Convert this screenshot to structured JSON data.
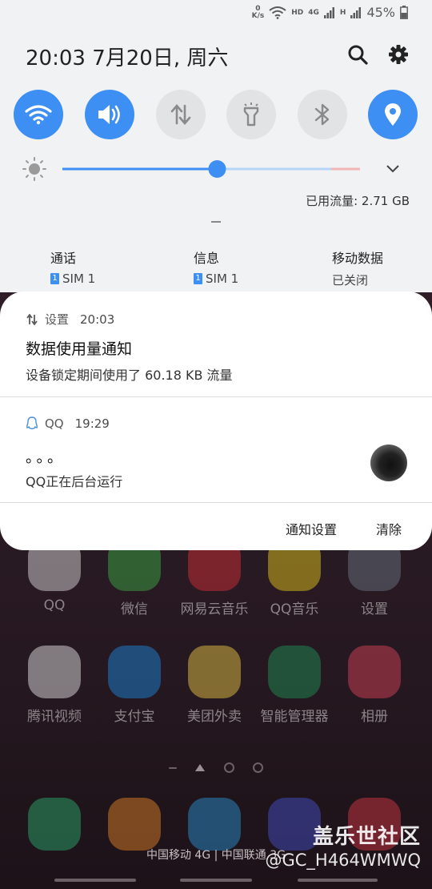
{
  "status_bar": {
    "speed_value": "0",
    "speed_unit": "K/s",
    "hd_label": "HD",
    "network_label": "4G",
    "hd2_label": "H",
    "battery": "45%"
  },
  "header": {
    "datetime": "20:03  7月20日, 周六"
  },
  "quick_settings": [
    {
      "name": "wifi",
      "icon": "wifi-icon",
      "on": true
    },
    {
      "name": "sound",
      "icon": "speaker-icon",
      "on": true
    },
    {
      "name": "mobile-data",
      "icon": "data-arrows-icon",
      "on": false
    },
    {
      "name": "flashlight",
      "icon": "flashlight-icon",
      "on": false
    },
    {
      "name": "bluetooth",
      "icon": "bluetooth-icon",
      "on": false
    },
    {
      "name": "location",
      "icon": "location-icon",
      "on": true
    }
  ],
  "brightness": {
    "level": 0.52
  },
  "data_usage": "已用流量: 2.71 GB",
  "sim_info": [
    {
      "label": "通话",
      "sub": "SIM 1",
      "badge": "1"
    },
    {
      "label": "信息",
      "sub": "SIM 1",
      "badge": "1"
    },
    {
      "label": "移动数据",
      "sub": "已关闭"
    }
  ],
  "notifications": [
    {
      "app": "设置",
      "time": "20:03",
      "title": "数据使用量通知",
      "body": "设备锁定期间使用了 60.18 KB 流量"
    },
    {
      "app": "QQ",
      "time": "19:29",
      "title": "。。。",
      "body": "QQ正在后台运行"
    }
  ],
  "actions": {
    "settings": "通知设置",
    "clear": "清除"
  },
  "home_apps_row1": [
    "QQ",
    "微信",
    "网易云音乐",
    "QQ音乐",
    "设置"
  ],
  "home_apps_row2": [
    "腾讯视频",
    "支付宝",
    "美团外卖",
    "智能管理器",
    "相册"
  ],
  "carrier": "中国移动 4G | 中国联通 3G",
  "watermark": {
    "line1": "盖乐世社区",
    "line2": "@GC_H464WMWQ"
  },
  "colors": {
    "accent": "#3e8ff3",
    "panel": "#f1f2f4",
    "off_toggle": "#e2e3e5"
  }
}
